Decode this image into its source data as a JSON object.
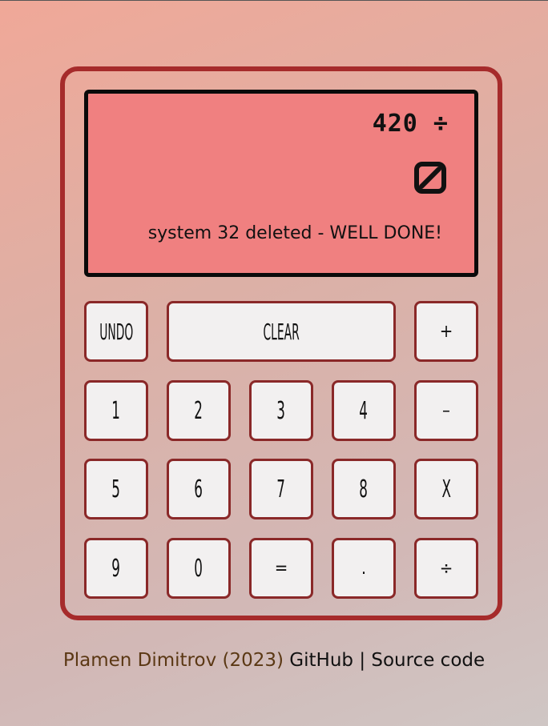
{
  "display": {
    "expression": "420 ÷",
    "result_icon": "empty-set-icon",
    "message": "system 32 deleted - WELL DONE!"
  },
  "keys": {
    "undo": "UNDO",
    "clear": "CLEAR",
    "plus": "+",
    "one": "1",
    "two": "2",
    "three": "3",
    "four": "4",
    "minus": "–",
    "five": "5",
    "six": "6",
    "seven": "7",
    "eight": "8",
    "multiply": "X",
    "nine": "9",
    "zero": "0",
    "equals": "=",
    "decimal": ".",
    "divide": "÷"
  },
  "footer": {
    "author": "Plamen Dimitrov (2023)",
    "github": "GitHub",
    "separator": "|",
    "source": "Source code"
  },
  "colors": {
    "screen": "#f08080",
    "frame": "#a62b2b",
    "key_border": "#8a2828",
    "key_bg": "#f2f0f0"
  }
}
